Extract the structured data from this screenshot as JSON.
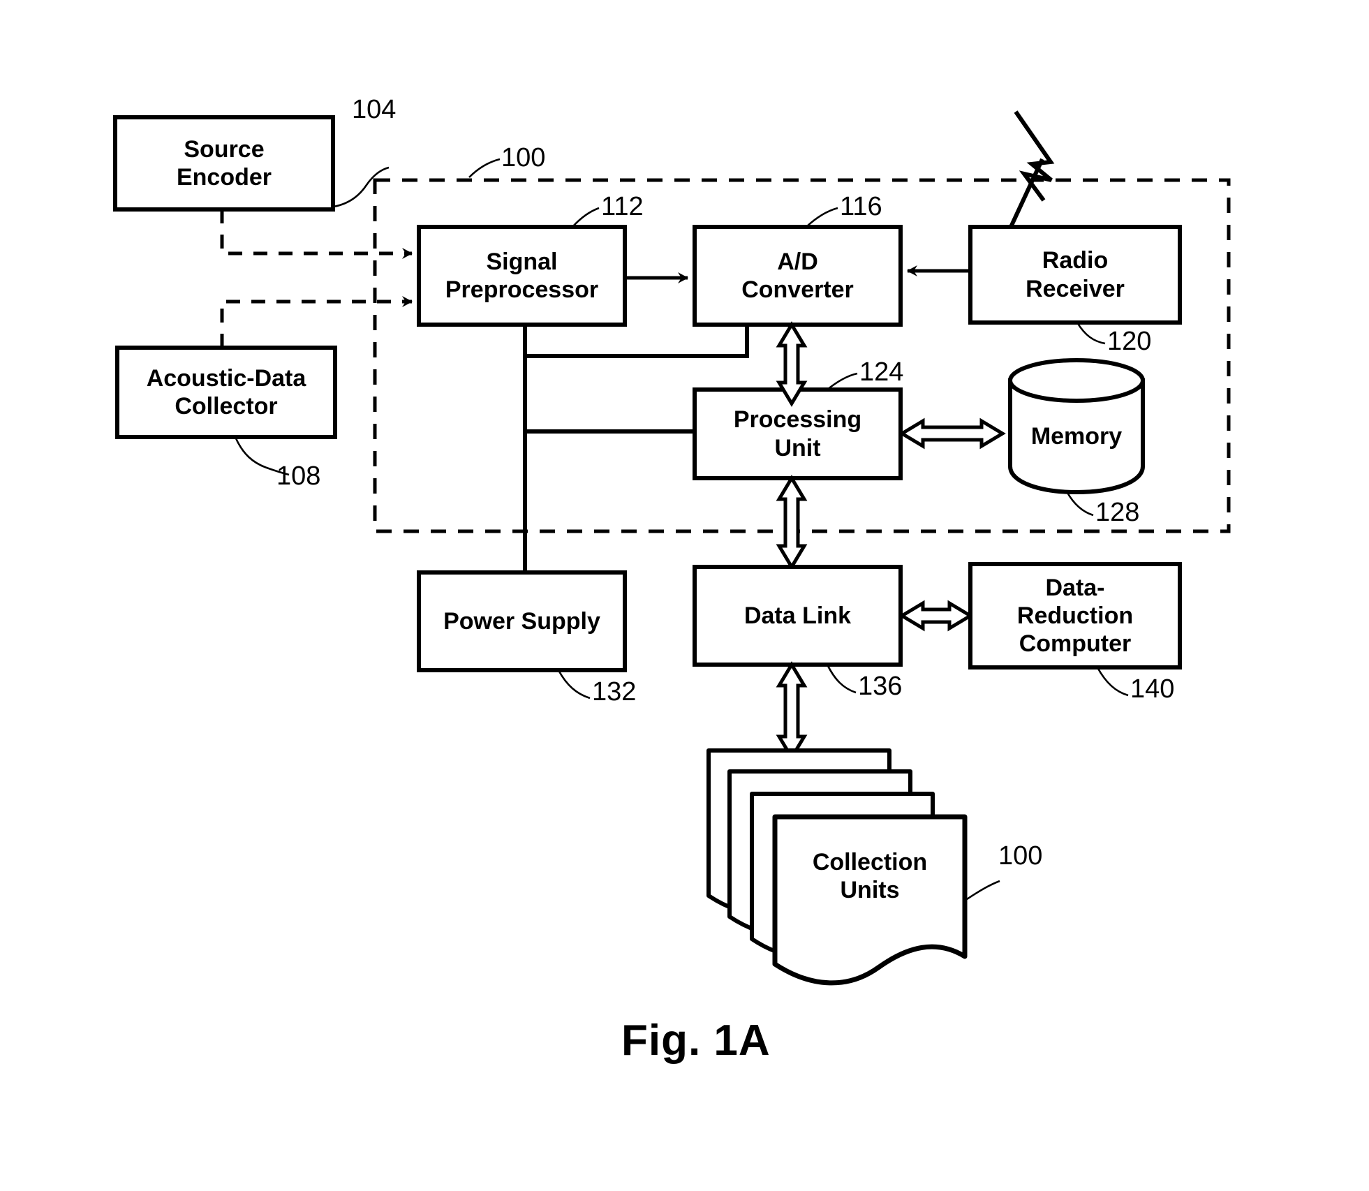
{
  "figure": {
    "caption": "Fig. 1A",
    "type": "block-diagram"
  },
  "blocks": {
    "source_encoder": {
      "label": "Source\nEncoder",
      "ref": "104"
    },
    "acoustic_data_collector": {
      "label": "Acoustic-Data\nCollector",
      "ref": "108"
    },
    "signal_preprocessor": {
      "label": "Signal\nPreprocessor",
      "ref": "112"
    },
    "ad_converter": {
      "label": "A/D\nConverter",
      "ref": "116"
    },
    "radio_receiver": {
      "label": "Radio\nReceiver",
      "ref": "120"
    },
    "processing_unit": {
      "label": "Processing\nUnit",
      "ref": "124"
    },
    "memory": {
      "label": "Memory",
      "ref": "128"
    },
    "power_supply": {
      "label": "Power Supply",
      "ref": "132"
    },
    "data_link": {
      "label": "Data Link",
      "ref": "136"
    },
    "data_reduction_computer": {
      "label": "Data-\nReduction\nComputer",
      "ref": "140"
    },
    "collection_units": {
      "label": "Collection\nUnits",
      "ref": "100"
    },
    "system_boundary": {
      "ref": "100"
    }
  },
  "icons": {
    "antenna": "antenna-lightning-icon",
    "memory_shape": "database-cylinder-icon",
    "collection_stack": "document-stack-icon"
  },
  "colors": {
    "stroke": "#000000",
    "background": "#ffffff"
  }
}
